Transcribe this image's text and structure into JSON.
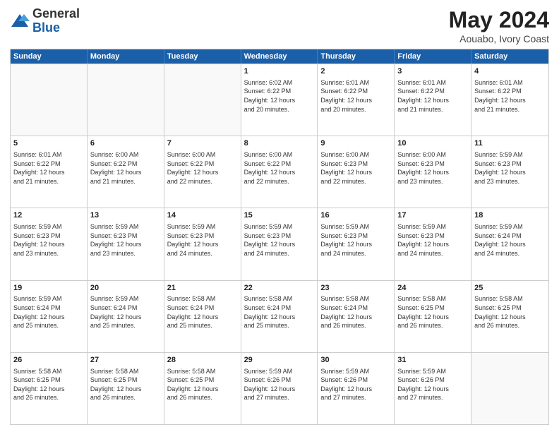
{
  "header": {
    "logo_general": "General",
    "logo_blue": "Blue",
    "title": "May 2024",
    "subtitle": "Aouabo, Ivory Coast"
  },
  "days_of_week": [
    "Sunday",
    "Monday",
    "Tuesday",
    "Wednesday",
    "Thursday",
    "Friday",
    "Saturday"
  ],
  "weeks": [
    [
      {
        "day": "",
        "empty": true
      },
      {
        "day": "",
        "empty": true
      },
      {
        "day": "",
        "empty": true
      },
      {
        "day": "1",
        "lines": [
          "Sunrise: 6:02 AM",
          "Sunset: 6:22 PM",
          "Daylight: 12 hours",
          "and 20 minutes."
        ]
      },
      {
        "day": "2",
        "lines": [
          "Sunrise: 6:01 AM",
          "Sunset: 6:22 PM",
          "Daylight: 12 hours",
          "and 20 minutes."
        ]
      },
      {
        "day": "3",
        "lines": [
          "Sunrise: 6:01 AM",
          "Sunset: 6:22 PM",
          "Daylight: 12 hours",
          "and 21 minutes."
        ]
      },
      {
        "day": "4",
        "lines": [
          "Sunrise: 6:01 AM",
          "Sunset: 6:22 PM",
          "Daylight: 12 hours",
          "and 21 minutes."
        ]
      }
    ],
    [
      {
        "day": "5",
        "lines": [
          "Sunrise: 6:01 AM",
          "Sunset: 6:22 PM",
          "Daylight: 12 hours",
          "and 21 minutes."
        ]
      },
      {
        "day": "6",
        "lines": [
          "Sunrise: 6:00 AM",
          "Sunset: 6:22 PM",
          "Daylight: 12 hours",
          "and 21 minutes."
        ]
      },
      {
        "day": "7",
        "lines": [
          "Sunrise: 6:00 AM",
          "Sunset: 6:22 PM",
          "Daylight: 12 hours",
          "and 22 minutes."
        ]
      },
      {
        "day": "8",
        "lines": [
          "Sunrise: 6:00 AM",
          "Sunset: 6:22 PM",
          "Daylight: 12 hours",
          "and 22 minutes."
        ]
      },
      {
        "day": "9",
        "lines": [
          "Sunrise: 6:00 AM",
          "Sunset: 6:23 PM",
          "Daylight: 12 hours",
          "and 22 minutes."
        ]
      },
      {
        "day": "10",
        "lines": [
          "Sunrise: 6:00 AM",
          "Sunset: 6:23 PM",
          "Daylight: 12 hours",
          "and 23 minutes."
        ]
      },
      {
        "day": "11",
        "lines": [
          "Sunrise: 5:59 AM",
          "Sunset: 6:23 PM",
          "Daylight: 12 hours",
          "and 23 minutes."
        ]
      }
    ],
    [
      {
        "day": "12",
        "lines": [
          "Sunrise: 5:59 AM",
          "Sunset: 6:23 PM",
          "Daylight: 12 hours",
          "and 23 minutes."
        ]
      },
      {
        "day": "13",
        "lines": [
          "Sunrise: 5:59 AM",
          "Sunset: 6:23 PM",
          "Daylight: 12 hours",
          "and 23 minutes."
        ]
      },
      {
        "day": "14",
        "lines": [
          "Sunrise: 5:59 AM",
          "Sunset: 6:23 PM",
          "Daylight: 12 hours",
          "and 24 minutes."
        ]
      },
      {
        "day": "15",
        "lines": [
          "Sunrise: 5:59 AM",
          "Sunset: 6:23 PM",
          "Daylight: 12 hours",
          "and 24 minutes."
        ]
      },
      {
        "day": "16",
        "lines": [
          "Sunrise: 5:59 AM",
          "Sunset: 6:23 PM",
          "Daylight: 12 hours",
          "and 24 minutes."
        ]
      },
      {
        "day": "17",
        "lines": [
          "Sunrise: 5:59 AM",
          "Sunset: 6:23 PM",
          "Daylight: 12 hours",
          "and 24 minutes."
        ]
      },
      {
        "day": "18",
        "lines": [
          "Sunrise: 5:59 AM",
          "Sunset: 6:24 PM",
          "Daylight: 12 hours",
          "and 24 minutes."
        ]
      }
    ],
    [
      {
        "day": "19",
        "lines": [
          "Sunrise: 5:59 AM",
          "Sunset: 6:24 PM",
          "Daylight: 12 hours",
          "and 25 minutes."
        ]
      },
      {
        "day": "20",
        "lines": [
          "Sunrise: 5:59 AM",
          "Sunset: 6:24 PM",
          "Daylight: 12 hours",
          "and 25 minutes."
        ]
      },
      {
        "day": "21",
        "lines": [
          "Sunrise: 5:58 AM",
          "Sunset: 6:24 PM",
          "Daylight: 12 hours",
          "and 25 minutes."
        ]
      },
      {
        "day": "22",
        "lines": [
          "Sunrise: 5:58 AM",
          "Sunset: 6:24 PM",
          "Daylight: 12 hours",
          "and 25 minutes."
        ]
      },
      {
        "day": "23",
        "lines": [
          "Sunrise: 5:58 AM",
          "Sunset: 6:24 PM",
          "Daylight: 12 hours",
          "and 26 minutes."
        ]
      },
      {
        "day": "24",
        "lines": [
          "Sunrise: 5:58 AM",
          "Sunset: 6:25 PM",
          "Daylight: 12 hours",
          "and 26 minutes."
        ]
      },
      {
        "day": "25",
        "lines": [
          "Sunrise: 5:58 AM",
          "Sunset: 6:25 PM",
          "Daylight: 12 hours",
          "and 26 minutes."
        ]
      }
    ],
    [
      {
        "day": "26",
        "lines": [
          "Sunrise: 5:58 AM",
          "Sunset: 6:25 PM",
          "Daylight: 12 hours",
          "and 26 minutes."
        ]
      },
      {
        "day": "27",
        "lines": [
          "Sunrise: 5:58 AM",
          "Sunset: 6:25 PM",
          "Daylight: 12 hours",
          "and 26 minutes."
        ]
      },
      {
        "day": "28",
        "lines": [
          "Sunrise: 5:58 AM",
          "Sunset: 6:25 PM",
          "Daylight: 12 hours",
          "and 26 minutes."
        ]
      },
      {
        "day": "29",
        "lines": [
          "Sunrise: 5:59 AM",
          "Sunset: 6:26 PM",
          "Daylight: 12 hours",
          "and 27 minutes."
        ]
      },
      {
        "day": "30",
        "lines": [
          "Sunrise: 5:59 AM",
          "Sunset: 6:26 PM",
          "Daylight: 12 hours",
          "and 27 minutes."
        ]
      },
      {
        "day": "31",
        "lines": [
          "Sunrise: 5:59 AM",
          "Sunset: 6:26 PM",
          "Daylight: 12 hours",
          "and 27 minutes."
        ]
      },
      {
        "day": "",
        "empty": true
      }
    ]
  ]
}
